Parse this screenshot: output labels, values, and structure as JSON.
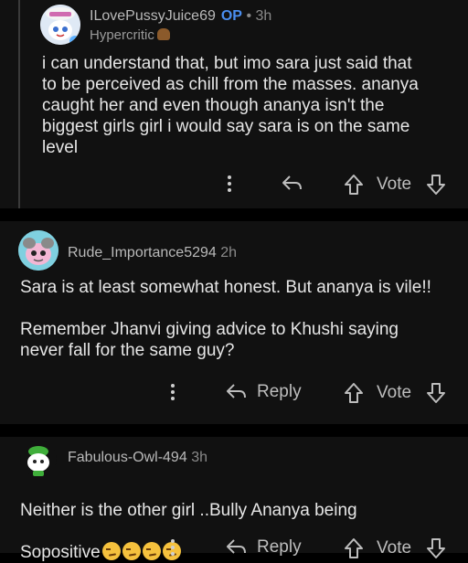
{
  "comments": [
    {
      "username": "ILovePussyJuice69",
      "op_badge": "OP",
      "separator": "•",
      "time": "3h",
      "flair": "Hypercritic",
      "flair_icon": "poop-emoji-icon",
      "body": "i can understand that, but imo sara just said that\nto be perceived as chill from the masses. ananya\ncaught her and even though ananya isn't the\nbiggest girls girl i would say sara is on the same\nlevel",
      "vote_label": "Vote"
    },
    {
      "username": "Rude_Importance5294",
      "time": "2h",
      "body": "Sara is at least somewhat honest. But ananya is vile!!\n\nRemember Jhanvi giving advice to Khushi saying\nnever fall for the same guy?",
      "reply_label": "Reply",
      "vote_label": "Vote"
    },
    {
      "username": "Fabulous-Owl-494",
      "time": "3h",
      "body_line1": "Neither is the other girl ..Bully Ananya being",
      "body_line2": "Sopositive",
      "emoji": "smirking-face-emoji x4",
      "reply_label": "Reply",
      "vote_label": "Vote"
    }
  ],
  "colors": {
    "background": "#000000",
    "card": "#111111",
    "op_badge": "#4a8ef0",
    "text": "#e6e6e6",
    "meta": "#8a8a8a"
  }
}
